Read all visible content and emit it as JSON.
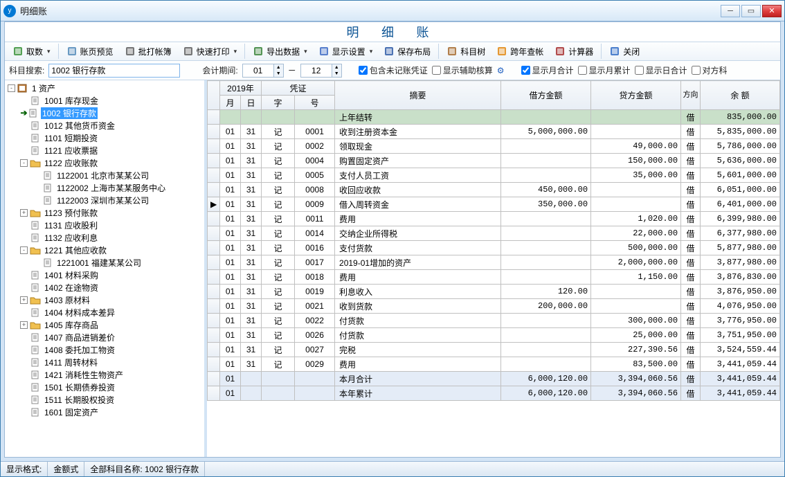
{
  "window": {
    "title": "明细账"
  },
  "heading": "明  细  账",
  "toolbar": [
    {
      "name": "fetch-data-button",
      "label": "取数",
      "icon": "arrow-down-green-icon",
      "dd": true
    },
    {
      "sep": true
    },
    {
      "name": "page-preview-button",
      "label": "账页预览",
      "icon": "preview-icon"
    },
    {
      "name": "batch-print-button",
      "label": "批打帐簿",
      "icon": "batch-print-icon"
    },
    {
      "name": "quick-print-button",
      "label": "快速打印",
      "icon": "printer-icon",
      "dd": true
    },
    {
      "sep": true
    },
    {
      "name": "export-button",
      "label": "导出数据",
      "icon": "export-icon",
      "dd": true
    },
    {
      "name": "display-settings-button",
      "label": "显示设置",
      "icon": "settings-icon",
      "dd": true
    },
    {
      "name": "save-layout-button",
      "label": "保存布局",
      "icon": "save-icon"
    },
    {
      "sep": true
    },
    {
      "name": "account-tree-button",
      "label": "科目树",
      "icon": "tree-icon"
    },
    {
      "name": "cross-year-button",
      "label": "跨年查帐",
      "icon": "lightning-icon"
    },
    {
      "name": "calculator-button",
      "label": "计算器",
      "icon": "calculator-icon"
    },
    {
      "sep": true
    },
    {
      "name": "close-button",
      "label": "关闭",
      "icon": "close-app-icon"
    }
  ],
  "filters": {
    "search_label": "科目搜索:",
    "search_value": "1002 银行存款",
    "period_label": "会计期间:",
    "period_from": "01",
    "period_to": "12",
    "include_unposted_label": "包含未记账凭证",
    "include_unposted": true,
    "show_aux_label": "显示辅助核算",
    "show_aux": false,
    "show_month_total_label": "显示月合计",
    "show_month_total": true,
    "show_month_accum_label": "显示月累计",
    "show_month_accum": false,
    "show_day_total_label": "显示日合计",
    "show_day_total": false,
    "counterpart_label": "对方科"
  },
  "tree": {
    "root": {
      "label": "1 资产",
      "exp": "-",
      "icon": "book"
    },
    "items": [
      {
        "level": 1,
        "label": "1001 库存现金",
        "icon": "page"
      },
      {
        "level": 1,
        "label": "1002 银行存款",
        "icon": "page",
        "selected": true
      },
      {
        "level": 1,
        "label": "1012 其他货币资金",
        "icon": "page"
      },
      {
        "level": 1,
        "label": "1101 短期投资",
        "icon": "page"
      },
      {
        "level": 1,
        "label": "1121 应收票据",
        "icon": "page"
      },
      {
        "level": 1,
        "label": "1122 应收账款",
        "icon": "folder",
        "exp": "-"
      },
      {
        "level": 2,
        "label": "1122001 北京市某某公司",
        "icon": "page"
      },
      {
        "level": 2,
        "label": "1122002 上海市某某服务中心",
        "icon": "page"
      },
      {
        "level": 2,
        "label": "1122003 深圳市某某公司",
        "icon": "page"
      },
      {
        "level": 1,
        "label": "1123 预付账款",
        "icon": "folder",
        "exp": "+"
      },
      {
        "level": 1,
        "label": "1131 应收股利",
        "icon": "page"
      },
      {
        "level": 1,
        "label": "1132 应收利息",
        "icon": "page"
      },
      {
        "level": 1,
        "label": "1221 其他应收款",
        "icon": "folder",
        "exp": "-"
      },
      {
        "level": 2,
        "label": "1221001 福建某某公司",
        "icon": "page"
      },
      {
        "level": 1,
        "label": "1401 材料采购",
        "icon": "page"
      },
      {
        "level": 1,
        "label": "1402 在途物资",
        "icon": "page"
      },
      {
        "level": 1,
        "label": "1403 原材料",
        "icon": "folder",
        "exp": "+"
      },
      {
        "level": 1,
        "label": "1404 材料成本差异",
        "icon": "page"
      },
      {
        "level": 1,
        "label": "1405 库存商品",
        "icon": "folder",
        "exp": "+"
      },
      {
        "level": 1,
        "label": "1407 商品进销差价",
        "icon": "page"
      },
      {
        "level": 1,
        "label": "1408 委托加工物资",
        "icon": "page"
      },
      {
        "level": 1,
        "label": "1411 周转材料",
        "icon": "page"
      },
      {
        "level": 1,
        "label": "1421 消耗性生物资产",
        "icon": "page"
      },
      {
        "level": 1,
        "label": "1501 长期债券投资",
        "icon": "page"
      },
      {
        "level": 1,
        "label": "1511 长期股权投资",
        "icon": "page"
      },
      {
        "level": 1,
        "label": "1601 固定资产",
        "icon": "page"
      }
    ]
  },
  "grid": {
    "header": {
      "year": "2019年",
      "voucher": "凭证",
      "month": "月",
      "day": "日",
      "word": "字",
      "no": "号",
      "summary": "摘要",
      "debit": "借方金额",
      "credit": "贷方金额",
      "dir": "方向",
      "balance": "余      额"
    },
    "rows": [
      {
        "type": "opening",
        "summary": "上年结转",
        "dir": "借",
        "balance": "835,000.00"
      },
      {
        "m": "01",
        "d": "31",
        "w": "记",
        "n": "0001",
        "summary": "收到注册资本金",
        "debit": "5,000,000.00",
        "credit": "",
        "dir": "借",
        "balance": "5,835,000.00"
      },
      {
        "m": "01",
        "d": "31",
        "w": "记",
        "n": "0002",
        "summary": "领取现金",
        "debit": "",
        "credit": "49,000.00",
        "dir": "借",
        "balance": "5,786,000.00"
      },
      {
        "m": "01",
        "d": "31",
        "w": "记",
        "n": "0004",
        "summary": "购置固定资产",
        "debit": "",
        "credit": "150,000.00",
        "dir": "借",
        "balance": "5,636,000.00"
      },
      {
        "m": "01",
        "d": "31",
        "w": "记",
        "n": "0005",
        "summary": "支付人员工资",
        "debit": "",
        "credit": "35,000.00",
        "dir": "借",
        "balance": "5,601,000.00"
      },
      {
        "m": "01",
        "d": "31",
        "w": "记",
        "n": "0008",
        "summary": "收回应收款",
        "debit": "450,000.00",
        "credit": "",
        "dir": "借",
        "balance": "6,051,000.00"
      },
      {
        "mark": true,
        "m": "01",
        "d": "31",
        "w": "记",
        "n": "0009",
        "summary": "借入周转资金",
        "debit": "350,000.00",
        "credit": "",
        "dir": "借",
        "balance": "6,401,000.00"
      },
      {
        "m": "01",
        "d": "31",
        "w": "记",
        "n": "0011",
        "summary": "费用",
        "debit": "",
        "credit": "1,020.00",
        "dir": "借",
        "balance": "6,399,980.00"
      },
      {
        "m": "01",
        "d": "31",
        "w": "记",
        "n": "0014",
        "summary": "交纳企业所得税",
        "debit": "",
        "credit": "22,000.00",
        "dir": "借",
        "balance": "6,377,980.00"
      },
      {
        "m": "01",
        "d": "31",
        "w": "记",
        "n": "0016",
        "summary": "支付货款",
        "debit": "",
        "credit": "500,000.00",
        "dir": "借",
        "balance": "5,877,980.00"
      },
      {
        "m": "01",
        "d": "31",
        "w": "记",
        "n": "0017",
        "summary": "2019-01增加的资产",
        "debit": "",
        "credit": "2,000,000.00",
        "dir": "借",
        "balance": "3,877,980.00"
      },
      {
        "m": "01",
        "d": "31",
        "w": "记",
        "n": "0018",
        "summary": "费用",
        "debit": "",
        "credit": "1,150.00",
        "dir": "借",
        "balance": "3,876,830.00"
      },
      {
        "m": "01",
        "d": "31",
        "w": "记",
        "n": "0019",
        "summary": "利息收入",
        "debit": "120.00",
        "credit": "",
        "dir": "借",
        "balance": "3,876,950.00"
      },
      {
        "m": "01",
        "d": "31",
        "w": "记",
        "n": "0021",
        "summary": "收到货款",
        "debit": "200,000.00",
        "credit": "",
        "dir": "借",
        "balance": "4,076,950.00"
      },
      {
        "m": "01",
        "d": "31",
        "w": "记",
        "n": "0022",
        "summary": "付货款",
        "debit": "",
        "credit": "300,000.00",
        "dir": "借",
        "balance": "3,776,950.00"
      },
      {
        "m": "01",
        "d": "31",
        "w": "记",
        "n": "0026",
        "summary": "付货款",
        "debit": "",
        "credit": "25,000.00",
        "dir": "借",
        "balance": "3,751,950.00"
      },
      {
        "m": "01",
        "d": "31",
        "w": "记",
        "n": "0027",
        "summary": "完税",
        "debit": "",
        "credit": "227,390.56",
        "dir": "借",
        "balance": "3,524,559.44"
      },
      {
        "m": "01",
        "d": "31",
        "w": "记",
        "n": "0029",
        "summary": "费用",
        "debit": "",
        "credit": "83,500.00",
        "dir": "借",
        "balance": "3,441,059.44"
      },
      {
        "type": "subtotal",
        "m": "01",
        "summary": "本月合计",
        "debit": "6,000,120.00",
        "credit": "3,394,060.56",
        "dir": "借",
        "balance": "3,441,059.44"
      },
      {
        "type": "subtotal",
        "m": "01",
        "summary": "本年累计",
        "debit": "6,000,120.00",
        "credit": "3,394,060.56",
        "dir": "借",
        "balance": "3,441,059.44"
      }
    ]
  },
  "statusbar": {
    "fmt_label": "显示格式:",
    "fmt_value": "金额式",
    "acct_label": "全部科目名称:",
    "acct_value": "1002 银行存款"
  },
  "icons": {
    "book": "#c08040",
    "folder": "#f0c040",
    "page": "#ffffff"
  }
}
